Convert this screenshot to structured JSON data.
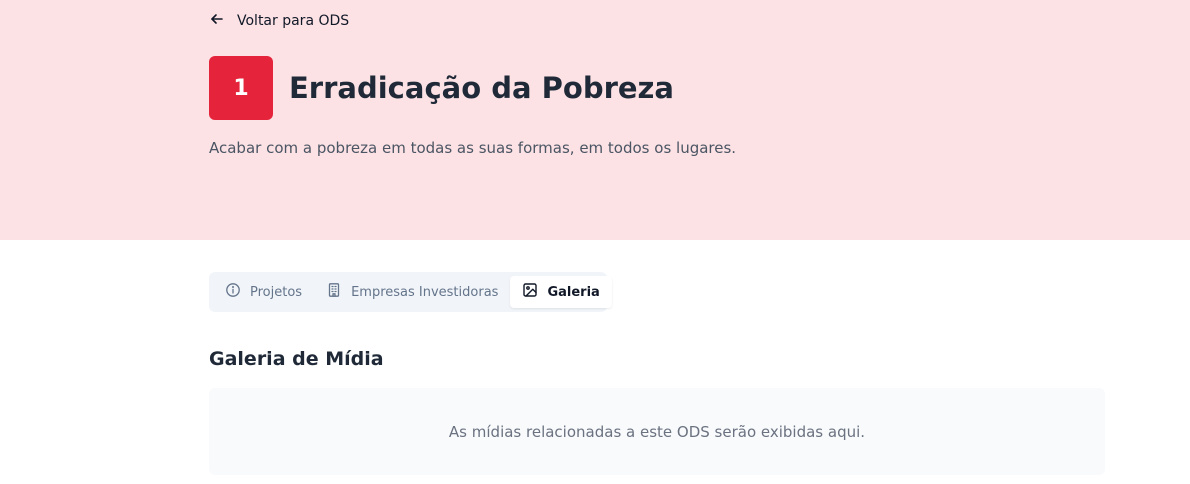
{
  "back_link": {
    "label": "Voltar para ODS",
    "icon": "arrow-left-icon"
  },
  "goal": {
    "number": "1",
    "title": "Erradicação da Pobreza",
    "description": "Acabar com a pobreza em todas as suas formas, em todos os lugares.",
    "color": "#e5243b",
    "hero_bg": "#fce2e5"
  },
  "tabs": [
    {
      "label": "Projetos",
      "icon": "info-circle-icon",
      "active": false
    },
    {
      "label": "Empresas Investidoras",
      "icon": "building-icon",
      "active": false
    },
    {
      "label": "Galeria",
      "icon": "image-icon",
      "active": true
    }
  ],
  "gallery": {
    "title": "Galeria de Mídia",
    "empty_message": "As mídias relacionadas a este ODS serão exibidas aqui."
  }
}
